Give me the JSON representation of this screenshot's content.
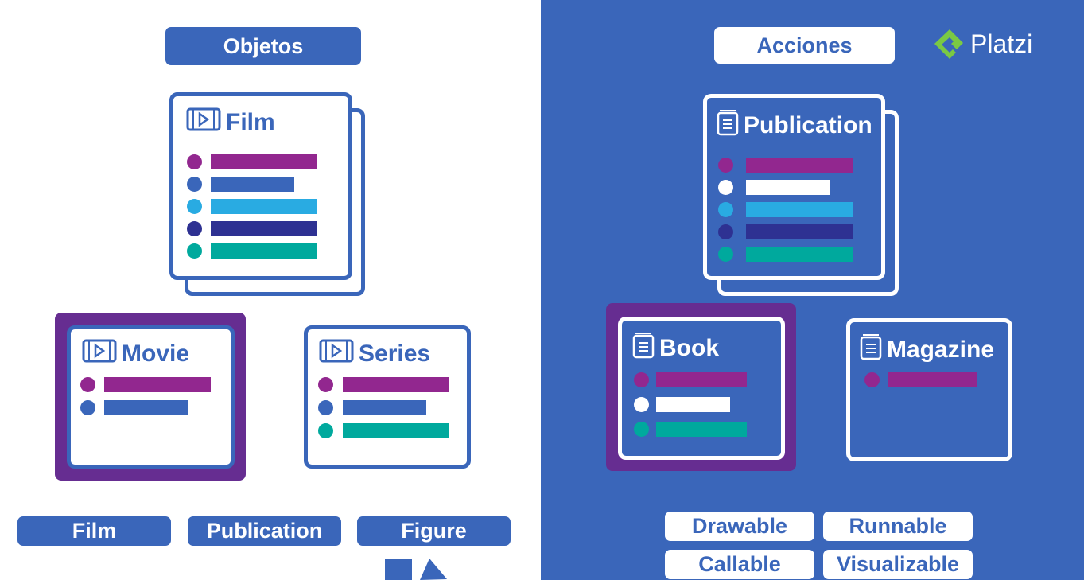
{
  "colors": {
    "blue": "#3a66ba",
    "purple": "#92278f",
    "light_blue": "#29abe2",
    "navy": "#2e3192",
    "teal": "#00a99d",
    "white": "#ffffff",
    "highlight_purple": "#662d91",
    "logo_green": "#7ac943"
  },
  "left_panel": {
    "header": "Objetos",
    "parent_card": {
      "title": "Film",
      "icon": "film-play-icon",
      "rows": [
        {
          "color": "#92278f",
          "fill": 1.0
        },
        {
          "color": "#3a66ba",
          "fill": 0.78
        },
        {
          "color": "#29abe2",
          "fill": 1.0
        },
        {
          "color": "#2e3192",
          "fill": 1.0
        },
        {
          "color": "#00a99d",
          "fill": 1.0
        }
      ]
    },
    "child_cards": [
      {
        "title": "Movie",
        "icon": "film-play-icon",
        "highlighted": true,
        "rows": [
          {
            "color": "#92278f",
            "fill": 1.0
          },
          {
            "color": "#3a66ba",
            "fill": 0.78
          }
        ]
      },
      {
        "title": "Series",
        "icon": "film-play-icon",
        "highlighted": false,
        "rows": [
          {
            "color": "#92278f",
            "fill": 1.0
          },
          {
            "color": "#3a66ba",
            "fill": 0.78
          },
          {
            "color": "#00a99d",
            "fill": 1.0
          }
        ]
      }
    ],
    "footer_labels": [
      "Film",
      "Publication",
      "Figure"
    ],
    "shapes": [
      "square",
      "triangle"
    ]
  },
  "right_panel": {
    "header": "Acciones",
    "brand": "Platzi",
    "parent_card": {
      "title": "Publication",
      "icon": "book-icon",
      "rows": [
        {
          "color": "#92278f",
          "fill": 1.0
        },
        {
          "color": "#ffffff",
          "fill": 0.78
        },
        {
          "color": "#29abe2",
          "fill": 1.0
        },
        {
          "color": "#2e3192",
          "fill": 1.0
        },
        {
          "color": "#00a99d",
          "fill": 1.0
        }
      ]
    },
    "child_cards": [
      {
        "title": "Book",
        "icon": "book-icon",
        "highlighted": true,
        "rows": [
          {
            "color": "#92278f",
            "fill": 1.0
          },
          {
            "color": "#ffffff",
            "fill": 0.82
          },
          {
            "color": "#00a99d",
            "fill": 1.0
          }
        ]
      },
      {
        "title": "Magazine",
        "icon": "book-icon",
        "highlighted": false,
        "rows": [
          {
            "color": "#92278f",
            "fill": 1.0
          }
        ]
      }
    ],
    "interfaces": [
      "Drawable",
      "Runnable",
      "Callable",
      "Visualizable"
    ]
  }
}
